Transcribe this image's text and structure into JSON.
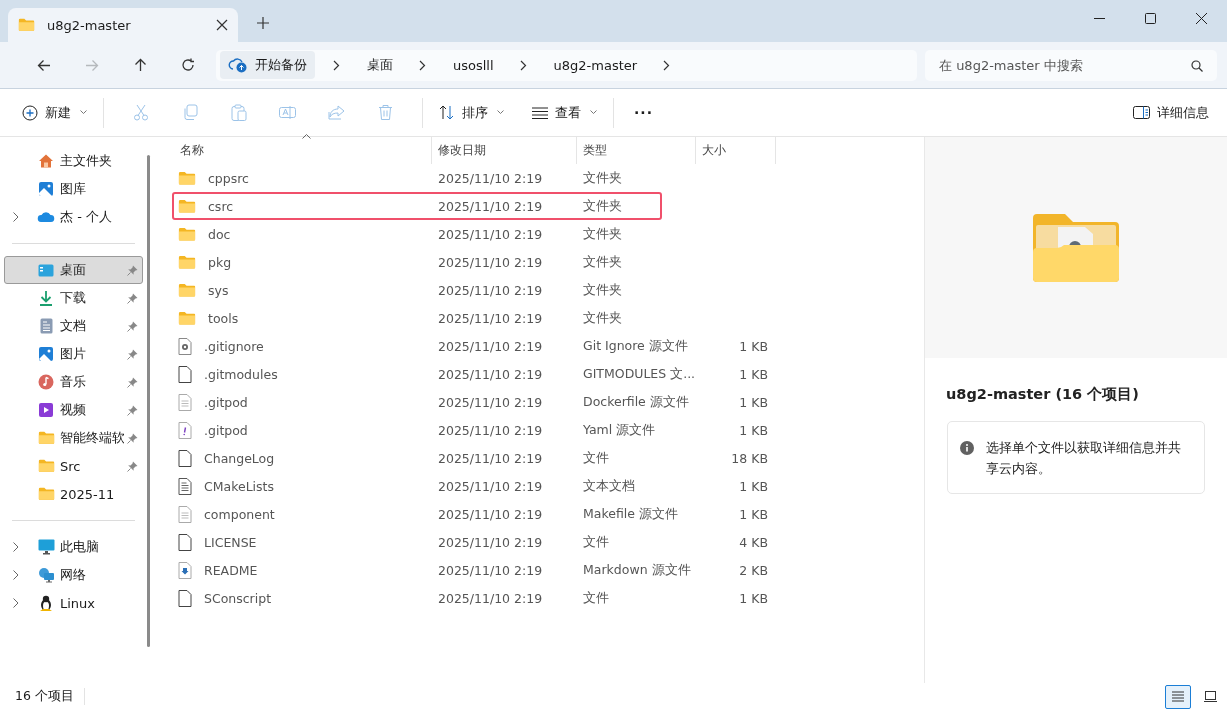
{
  "tabs": [
    {
      "title": "u8g2-master",
      "selected": true
    }
  ],
  "nav": {
    "backup": "开始备份",
    "breadcrumbs": [
      "桌面",
      "usoslll",
      "u8g2-master"
    ],
    "search_placeholder": "在 u8g2-master 中搜索",
    "forward_disabled": true
  },
  "toolbar": {
    "new": "新建",
    "actions": [
      {
        "kind": "cut",
        "disabled": true
      },
      {
        "kind": "copy",
        "disabled": true
      },
      {
        "kind": "paste",
        "disabled": true
      },
      {
        "kind": "rename",
        "disabled": true
      },
      {
        "kind": "share",
        "disabled": true
      },
      {
        "kind": "delete",
        "disabled": true
      }
    ],
    "sort": "排序",
    "view": "查看",
    "more": "···",
    "details": "详细信息"
  },
  "sidebar": {
    "groups": [
      {
        "items": [
          {
            "label": "主文件夹",
            "kind": "home",
            "expandable": false,
            "pinned": false,
            "selected": false
          },
          {
            "label": "图库",
            "kind": "gallery",
            "expandable": false,
            "pinned": false,
            "selected": false
          },
          {
            "label": "杰 - 个人",
            "kind": "cloud",
            "expandable": true,
            "pinned": false,
            "selected": false
          }
        ]
      },
      {
        "items": [
          {
            "label": "桌面",
            "kind": "desktop",
            "expandable": false,
            "pinned": true,
            "selected": true
          },
          {
            "label": "下载",
            "kind": "download",
            "expandable": false,
            "pinned": true,
            "selected": false
          },
          {
            "label": "文档",
            "kind": "documents",
            "expandable": false,
            "pinned": true,
            "selected": false
          },
          {
            "label": "图片",
            "kind": "pictures",
            "expandable": false,
            "pinned": true,
            "selected": false
          },
          {
            "label": "音乐",
            "kind": "music",
            "expandable": false,
            "pinned": true,
            "selected": false
          },
          {
            "label": "视频",
            "kind": "videos",
            "expandable": false,
            "pinned": true,
            "selected": false
          },
          {
            "label": "智能终端软",
            "kind": "folder",
            "expandable": false,
            "pinned": true,
            "selected": false
          },
          {
            "label": "Src",
            "kind": "folder",
            "expandable": false,
            "pinned": true,
            "selected": false
          },
          {
            "label": "2025-11",
            "kind": "folder",
            "expandable": false,
            "pinned": false,
            "selected": false
          }
        ]
      },
      {
        "items": [
          {
            "label": "此电脑",
            "kind": "pc",
            "expandable": true,
            "pinned": false,
            "selected": false
          },
          {
            "label": "网络",
            "kind": "network",
            "expandable": true,
            "pinned": false,
            "selected": false
          },
          {
            "label": "Linux",
            "kind": "linux",
            "expandable": true,
            "pinned": false,
            "selected": false
          }
        ]
      }
    ]
  },
  "table": {
    "columns": [
      "名称",
      "修改日期",
      "类型",
      "大小"
    ],
    "rows": [
      {
        "name": "cppsrc",
        "date": "2025/11/10 2:19",
        "type": "文件夹",
        "kind": "folder",
        "highlighted": false
      },
      {
        "name": "csrc",
        "date": "2025/11/10 2:19",
        "type": "文件夹",
        "kind": "folder",
        "highlighted": true
      },
      {
        "name": "doc",
        "date": "2025/11/10 2:19",
        "type": "文件夹",
        "kind": "folder",
        "highlighted": false
      },
      {
        "name": "pkg",
        "date": "2025/11/10 2:19",
        "type": "文件夹",
        "kind": "folder",
        "highlighted": false
      },
      {
        "name": "sys",
        "date": "2025/11/10 2:19",
        "type": "文件夹",
        "kind": "folder",
        "highlighted": false
      },
      {
        "name": "tools",
        "date": "2025/11/10 2:19",
        "type": "文件夹",
        "kind": "folder",
        "highlighted": false
      },
      {
        "name": ".gitignore",
        "date": "2025/11/10 2:19",
        "type": "Git Ignore 源文件",
        "size": "1 KB",
        "kind": "config",
        "highlighted": false
      },
      {
        "name": ".gitmodules",
        "date": "2025/11/10 2:19",
        "type": "GITMODULES 文...",
        "size": "1 KB",
        "kind": "file",
        "highlighted": false
      },
      {
        "name": ".gitpod",
        "date": "2025/11/10 2:19",
        "type": "Dockerfile 源文件",
        "size": "1 KB",
        "kind": "source",
        "highlighted": false
      },
      {
        "name": ".gitpod",
        "date": "2025/11/10 2:19",
        "type": "Yaml 源文件",
        "size": "1 KB",
        "kind": "yaml",
        "highlighted": false
      },
      {
        "name": "ChangeLog",
        "date": "2025/11/10 2:19",
        "type": "文件",
        "size": "18 KB",
        "kind": "file",
        "highlighted": false
      },
      {
        "name": "CMakeLists",
        "date": "2025/11/10 2:19",
        "type": "文本文档",
        "size": "1 KB",
        "kind": "text",
        "highlighted": false
      },
      {
        "name": "component",
        "date": "2025/11/10 2:19",
        "type": "Makefile 源文件",
        "size": "1 KB",
        "kind": "source",
        "highlighted": false
      },
      {
        "name": "LICENSE",
        "date": "2025/11/10 2:19",
        "type": "文件",
        "size": "4 KB",
        "kind": "file",
        "highlighted": false
      },
      {
        "name": "README",
        "date": "2025/11/10 2:19",
        "type": "Markdown 源文件",
        "size": "2 KB",
        "kind": "markdown",
        "highlighted": false
      },
      {
        "name": "SConscript",
        "date": "2025/11/10 2:19",
        "type": "文件",
        "size": "1 KB",
        "kind": "file",
        "highlighted": false
      }
    ]
  },
  "details": {
    "title": "u8g2-master (16 个项目)",
    "info": "选择单个文件以获取详细信息并共享云内容。"
  },
  "status_bar": {
    "count": "16 个项目",
    "views": [
      {
        "kind": "details",
        "selected": true
      },
      {
        "kind": "tiles",
        "selected": false
      }
    ]
  }
}
